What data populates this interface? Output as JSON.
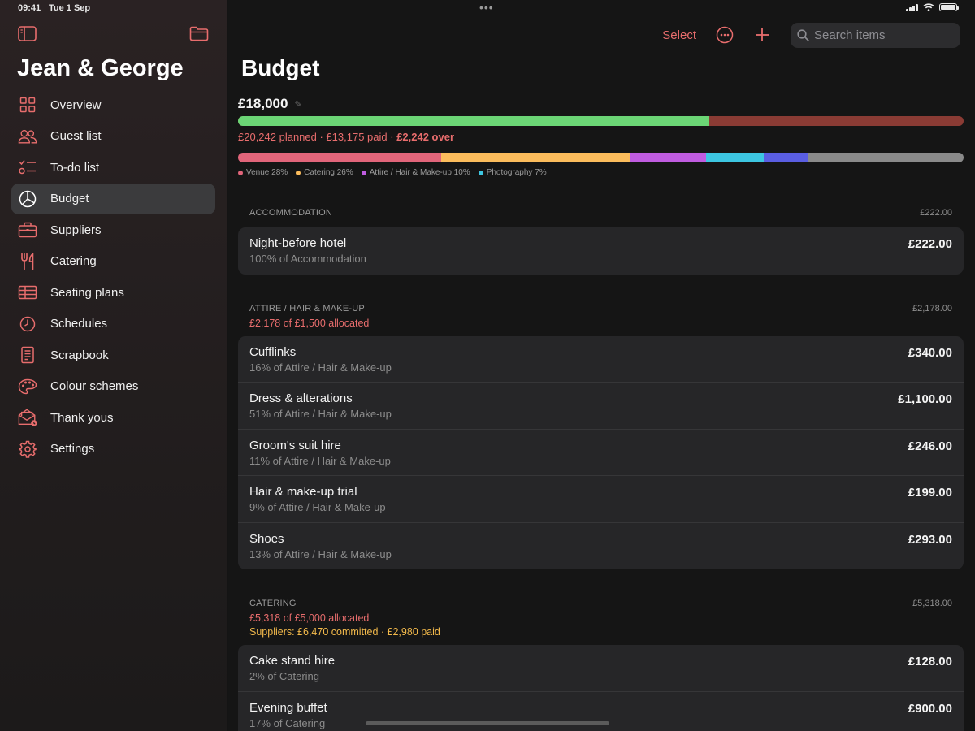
{
  "status": {
    "time": "09:41",
    "date": "Tue 1 Sep"
  },
  "sidebar": {
    "title": "Jean & George",
    "items": [
      {
        "label": "Overview",
        "icon": "grid-icon"
      },
      {
        "label": "Guest list",
        "icon": "people-icon"
      },
      {
        "label": "To-do list",
        "icon": "checklist-icon"
      },
      {
        "label": "Budget",
        "icon": "pie-chart-icon",
        "active": true
      },
      {
        "label": "Suppliers",
        "icon": "briefcase-icon"
      },
      {
        "label": "Catering",
        "icon": "fork-knife-icon"
      },
      {
        "label": "Seating plans",
        "icon": "table-icon"
      },
      {
        "label": "Schedules",
        "icon": "clock-icon"
      },
      {
        "label": "Scrapbook",
        "icon": "notebook-icon"
      },
      {
        "label": "Colour schemes",
        "icon": "palette-icon"
      },
      {
        "label": "Thank yous",
        "icon": "envelope-icon"
      },
      {
        "label": "Settings",
        "icon": "gear-icon"
      }
    ]
  },
  "toolbar": {
    "select_label": "Select",
    "search_placeholder": "Search items"
  },
  "page": {
    "title": "Budget",
    "total": "£18,000",
    "paid_fraction": 0.65,
    "summary_planned": "£20,242 planned",
    "summary_paid": "£13,175 paid",
    "summary_over": "£2,242 over",
    "sep": " · "
  },
  "categories_bar": [
    {
      "share": 28,
      "color": "#e1657a"
    },
    {
      "share": 26,
      "color": "#fbbc5c"
    },
    {
      "share": 10.5,
      "color": "#c05ce0"
    },
    {
      "share": 8,
      "color": "#3dc6e1"
    },
    {
      "share": 6,
      "color": "#5a5ee2"
    },
    {
      "share": 21.5,
      "color": "#8a8a8a"
    }
  ],
  "legend": [
    {
      "label": "Venue 28%",
      "color": "#e1657a"
    },
    {
      "label": "Catering 26%",
      "color": "#fbbc5c"
    },
    {
      "label": "Attire / Hair & Make-up 10%",
      "color": "#c05ce0"
    },
    {
      "label": "Photography 7%",
      "color": "#3dc6e1"
    }
  ],
  "sections": [
    {
      "name": "ACCOMMODATION",
      "amount": "£222.00",
      "items": [
        {
          "name": "Night-before hotel",
          "share": "100% of Accommodation",
          "amount": "£222.00"
        }
      ]
    },
    {
      "name": "ATTIRE / HAIR & MAKE-UP",
      "amount": "£2,178.00",
      "alloc": "£2,178 of £1,500 allocated",
      "items": [
        {
          "name": "Cufflinks",
          "share": "16% of Attire / Hair & Make-up",
          "amount": "£340.00"
        },
        {
          "name": "Dress & alterations",
          "share": "51% of Attire / Hair & Make-up",
          "amount": "£1,100.00"
        },
        {
          "name": "Groom's suit hire",
          "share": "11% of Attire / Hair & Make-up",
          "amount": "£246.00"
        },
        {
          "name": "Hair & make-up trial",
          "share": "9% of Attire / Hair & Make-up",
          "amount": "£199.00"
        },
        {
          "name": "Shoes",
          "share": "13% of Attire / Hair & Make-up",
          "amount": "£293.00"
        }
      ]
    },
    {
      "name": "CATERING",
      "amount": "£5,318.00",
      "alloc": "£5,318 of £5,000 allocated",
      "suppliers": "Suppliers: £6,470 committed · £2,980 paid",
      "items": [
        {
          "name": "Cake stand hire",
          "share": "2% of Catering",
          "amount": "£128.00"
        },
        {
          "name": "Evening buffet",
          "share": "17% of Catering",
          "amount": "£900.00"
        }
      ]
    }
  ]
}
